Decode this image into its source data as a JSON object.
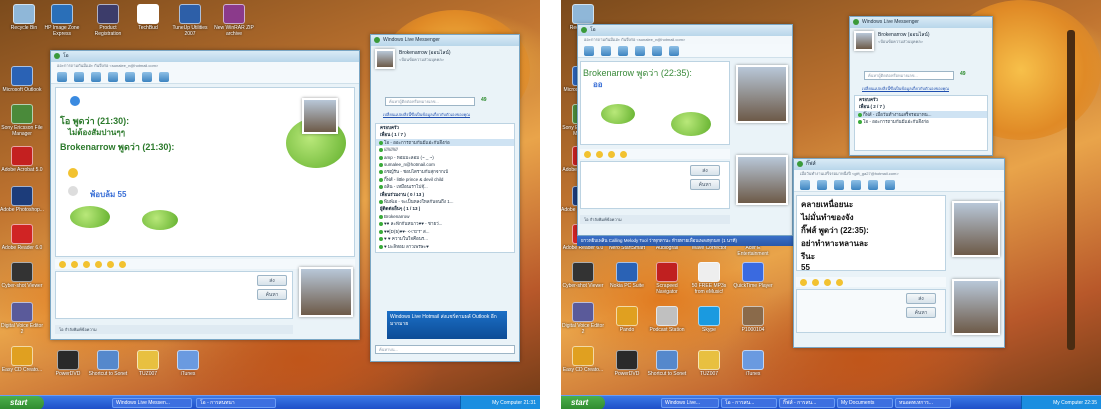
{
  "left": {
    "desktop_icons": [
      {
        "label": "Recycle Bin"
      },
      {
        "label": "HP Image Zone Express"
      },
      {
        "label": "Product Registration"
      },
      {
        "label": "TechBud"
      },
      {
        "label": "TuneUp Utilities 2007"
      },
      {
        "label": "New WinRAR ZIP archive"
      },
      {
        "label": "Microsoft Outlook"
      },
      {
        "label": "Sony Ericsson File Manager"
      },
      {
        "label": "Adobe Acrobat 5.0"
      },
      {
        "label": "Adobe Photoshop..."
      },
      {
        "label": "Adobe Reader 6.0"
      },
      {
        "label": "Cyber-shot Viewer"
      },
      {
        "label": "Digital Voice Editor 2"
      },
      {
        "label": "Easy CD Creato..."
      },
      {
        "label": "PowerDVD"
      },
      {
        "label": "Shortcut to Sonet"
      },
      {
        "label": "TUZ007"
      },
      {
        "label": "iTunes"
      }
    ],
    "chat_window": {
      "title": "โอ",
      "subtitle": "ออะการถามกันมีแอ่ะ กันจึงก่อ <sunalee_n@hotmail.com>",
      "messages": [
        {
          "name": "โอ พูดว่า (21:30):",
          "text": "ไม่ต้องสัมปานๆๆ"
        },
        {
          "name": "Brokenarrow พูดว่า (21:30):",
          "text": "พ้อบล้ม 55"
        }
      ],
      "send_button": "ส่ง",
      "search_button": "ค้นหา",
      "status": "โอ กำลังพิมพ์ข้อความ"
    },
    "messenger": {
      "title": "Windows Live Messenger",
      "user_name": "Brokenarrow (ออนไลน์)",
      "personal_message": "<ป้อนข้อความส่วนบุคคล>",
      "search_placeholder": "ค้นหาผู้ติดต่อหรือหมายเลข...",
      "contact_count": "49",
      "info_link": "เปลี่ยนแปลงสิ่งนี้ซึ่งเป็นข้อมูลเกี่ยวกับตัวเองของคุณ",
      "contacts": [
        {
          "label": "ครอบครัว",
          "kind": "grp"
        },
        {
          "label": "เพื่อน ( 1 / 7 )",
          "kind": "grp"
        },
        {
          "label": "โอ - ออะการถามกันมีแอ่ะกันจึงก่อ",
          "kind": "person",
          "selected": true
        },
        {
          "label": "///////////",
          "kind": "person"
        },
        {
          "label": "amp - หอมมะลอม (~ _ ~)",
          "kind": "person"
        },
        {
          "label": "sumalee_n@hotmail.com",
          "kind": "person"
        },
        {
          "label": "อชญ์รัน - ชอบไตรามกับสุกจากเป๋",
          "kind": "person"
        },
        {
          "label": "กิ๊ฟส์ - little prince & devil child",
          "kind": "person"
        },
        {
          "label": "อลิน - เหมือนเราไปจุ๊...",
          "kind": "person"
        },
        {
          "label": "เพื่อนร่วมงาน ( 0 / 13 )",
          "kind": "grp"
        },
        {
          "label": "พิมพ์เอ - จะเป็นหลงใหลกันจนถึง 1...",
          "kind": "person"
        },
        {
          "label": "ผู้ติดต่ออื่นๆ ( 1 / 13 )",
          "kind": "grp"
        },
        {
          "label": "Brokenarrow",
          "kind": "person"
        },
        {
          "label": "♥♥ ละฟักกันหนาว♥♥ - ชายว่...",
          "kind": "person"
        },
        {
          "label": "♥♥[D(ธ)♥♥- <<'G'T' ส...",
          "kind": "person"
        },
        {
          "label": "♥ ♥ ความในใจคือนร...",
          "kind": "person"
        },
        {
          "label": "♥ มะลิหอม ลาวเพรษะ♥",
          "kind": "person"
        }
      ],
      "banner": "Windows Live Hotmail ส่งแชร์ตามผลั Outlook อีกมากมาย",
      "search_bottom": "ค้นหาบน..."
    },
    "taskbar": {
      "start": "start",
      "items": [
        "Windows Live Messen...",
        "โอ - การสนทนา"
      ],
      "tray_text": "My Computer",
      "clock": "21:31"
    }
  },
  "right": {
    "desktop_icons": [
      {
        "label": "Recycle Bin"
      },
      {
        "label": "Microsoft Outlook"
      },
      {
        "label": "Sony Ericsson File Manager"
      },
      {
        "label": "Adobe Acrobat 5.0"
      },
      {
        "label": "Adobe Photoshop..."
      },
      {
        "label": "Adobe Reader 6.0"
      },
      {
        "label": "Cyber-shot Viewer"
      },
      {
        "label": "Digital Voice Editor 2"
      },
      {
        "label": "Easy CD Creato..."
      },
      {
        "label": "Nero StartSmart"
      },
      {
        "label": "Audiograil"
      },
      {
        "label": "Wave Corrector"
      },
      {
        "label": "Acer E Entertainment"
      },
      {
        "label": "Nokia PC Suite"
      },
      {
        "label": "Scrapeed Navigator"
      },
      {
        "label": "50 FREE MP3s from eMusic!"
      },
      {
        "label": "QuickTime Player"
      },
      {
        "label": "Pando"
      },
      {
        "label": "Podcast Station"
      },
      {
        "label": "Skype"
      },
      {
        "label": "P1000104"
      },
      {
        "label": "PowerDVD"
      },
      {
        "label": "Shortcut to Sonet"
      },
      {
        "label": "TUZ007"
      },
      {
        "label": "iTunes"
      }
    ],
    "chat_back": {
      "title": "โอ",
      "subtitle": "ออะการถามกันมีแอ่ะ กันจึงก่อ <sunalee_n@hotmail.com>",
      "message_name": "Brokenarrow พูดว่า (22:35):",
      "message_text": "ออ",
      "send_button": "ส่ง",
      "search_button": "ค้นหา",
      "status": "โอ กำลังพิมพ์ข้อความ"
    },
    "notice": "ยาวหยิบเพลิน Calling Melody Tool ว่าทุกทานะ ท้ายทายเพื่อนเพลงทุกน!!! (1 นาที)",
    "messenger": {
      "title": "Windows Live Messenger",
      "user_name": "Brokenarrow (ออนไลน์)",
      "personal_message": "<ป้อนข้อความส่วนบุคคล>",
      "search_placeholder": "ค้นหาผู้ติดต่อหรือหมายเลข...",
      "contact_count": "49",
      "info_link": "เปลี่ยนแปลงสิ่งนี้ซึ่งเป็นข้อมูลเกี่ยวกับตัวเองของคุณ",
      "contacts": [
        {
          "label": "ครอบครัว",
          "kind": "grp"
        },
        {
          "label": "เพื่อน ( 2 / 7 )",
          "kind": "grp"
        },
        {
          "label": "กิ๊ฟส์ - เมื่อวันทำงานเสร็จรอมาหน...",
          "kind": "person",
          "selected": true
        },
        {
          "label": "โอ - ออะการถามกันมีแอ่ะกันจึงก่อ",
          "kind": "person"
        }
      ]
    },
    "chat_front": {
      "title": "กิ๊ฟส์",
      "subtitle": "เมื่อวันทำงานเสร็จรอมาหนึ่งปี <gift_ga27@hotmail.com>",
      "lines": [
        "คลายเหนื่อยนะ",
        "ไม่มั่นทำของจัง",
        "กิ๊ฟส์ พูดว่า (22:35):",
        "อย่าทำหาะหลานละ",
        "รีนะ",
        "55"
      ],
      "send_button": "ส่ง",
      "search_button": "ค้นหา"
    },
    "taskbar": {
      "start": "start",
      "items": [
        "Windows Live...",
        "โอ - การสน...",
        "กิ๊ฟส์ - การสน...",
        "My Documents",
        "หนอดทเหการ..."
      ],
      "tray_text": "My Computer",
      "clock": "22:35"
    }
  }
}
